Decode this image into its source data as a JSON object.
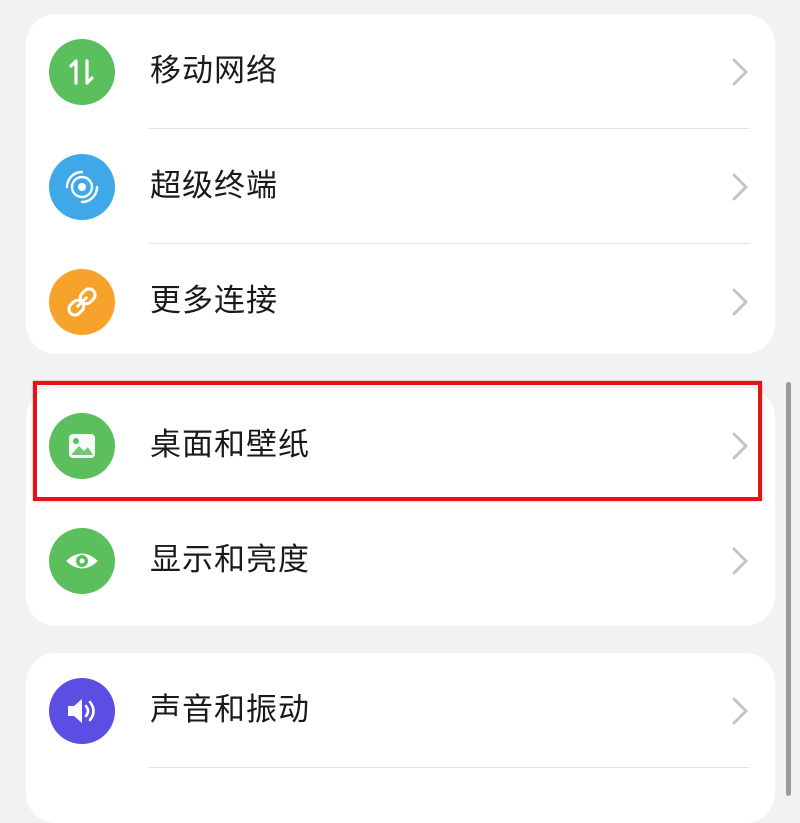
{
  "colors": {
    "page_bg": "#f1f2f4",
    "card_bg": "#ffffff",
    "highlight": "#e3131a"
  },
  "groups": [
    {
      "items": [
        {
          "label": "移动网络",
          "icon": "mobile-data-icon",
          "icon_color": "#5bbf5e"
        },
        {
          "label": "超级终端",
          "icon": "super-device-icon",
          "icon_color": "#3fa8e8"
        },
        {
          "label": "更多连接",
          "icon": "link-icon",
          "icon_color": "#f7a22b"
        }
      ]
    },
    {
      "items": [
        {
          "label": "桌面和壁纸",
          "icon": "wallpaper-icon",
          "icon_color": "#5bbf5e",
          "highlighted": true
        },
        {
          "label": "显示和亮度",
          "icon": "eye-icon",
          "icon_color": "#5bbf5e"
        }
      ]
    },
    {
      "items": [
        {
          "label": "声音和振动",
          "icon": "speaker-icon",
          "icon_color": "#5b4fe3"
        }
      ]
    }
  ]
}
